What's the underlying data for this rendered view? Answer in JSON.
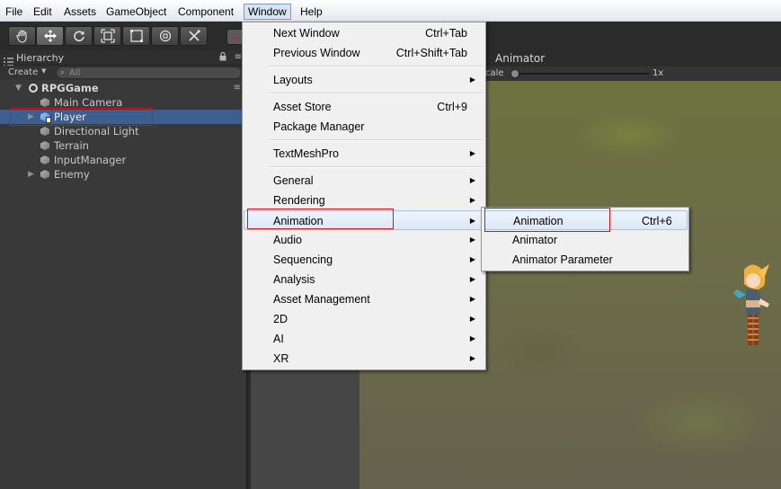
{
  "menubar": {
    "items": [
      "File",
      "Edit",
      "Assets",
      "GameObject",
      "Component",
      "Window",
      "Help"
    ],
    "active": "Window"
  },
  "toolbar": {
    "tools": [
      "hand-tool-icon",
      "move-tool-icon",
      "rotate-tool-icon",
      "scale-tool-icon",
      "rect-tool-icon",
      "transform-tool-icon",
      "custom-tool-icon"
    ],
    "selected": "move-tool-icon"
  },
  "hierarchy": {
    "tab_label": "Hierarchy",
    "create_label": "Create",
    "search_placeholder": "All",
    "scene_name": "RPGGame",
    "items": [
      {
        "label": "Main Camera",
        "expandable": false,
        "selected": false
      },
      {
        "label": "Player",
        "expandable": true,
        "selected": true
      },
      {
        "label": "Directional Light",
        "expandable": false,
        "selected": false
      },
      {
        "label": "Terrain",
        "expandable": false,
        "selected": false
      },
      {
        "label": "InputManager",
        "expandable": false,
        "selected": false
      },
      {
        "label": "Enemy",
        "expandable": true,
        "selected": false
      }
    ]
  },
  "animator_panel": {
    "tab_label": "Animator",
    "scale_label": "cale",
    "zoom_value": "1x"
  },
  "window_menu": {
    "items": [
      {
        "label": "Next Window",
        "shortcut": "Ctrl+Tab"
      },
      {
        "label": "Previous Window",
        "shortcut": "Ctrl+Shift+Tab"
      },
      {
        "label": "Layouts",
        "submenu": true
      },
      {
        "label": "Asset Store",
        "shortcut": "Ctrl+9"
      },
      {
        "label": "Package Manager"
      },
      {
        "label": "TextMeshPro",
        "submenu": true
      },
      {
        "label": "General",
        "submenu": true
      },
      {
        "label": "Rendering",
        "submenu": true
      },
      {
        "label": "Animation",
        "submenu": true,
        "highlighted": true
      },
      {
        "label": "Audio",
        "submenu": true
      },
      {
        "label": "Sequencing",
        "submenu": true
      },
      {
        "label": "Analysis",
        "submenu": true
      },
      {
        "label": "Asset Management",
        "submenu": true
      },
      {
        "label": "2D",
        "submenu": true
      },
      {
        "label": "AI",
        "submenu": true
      },
      {
        "label": "XR",
        "submenu": true
      }
    ]
  },
  "animation_submenu": {
    "items": [
      {
        "label": "Animation",
        "shortcut": "Ctrl+6",
        "highlighted": true
      },
      {
        "label": "Animator"
      },
      {
        "label": "Animator Parameter"
      }
    ]
  },
  "colors": {
    "selection": "#3d5f8e",
    "highlight_box": "#d11111",
    "menu_bg": "#f0f0f0"
  }
}
